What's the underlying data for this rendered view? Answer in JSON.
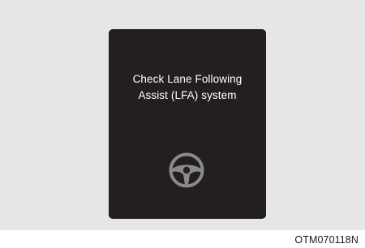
{
  "display": {
    "message_line1": "Check Lane Following",
    "message_line2": "Assist (LFA) system",
    "icon": "steering-wheel-icon",
    "screen_color": "#231f20",
    "icon_color": "#8a8a8a"
  },
  "figure": {
    "code": "OTM070118N"
  }
}
